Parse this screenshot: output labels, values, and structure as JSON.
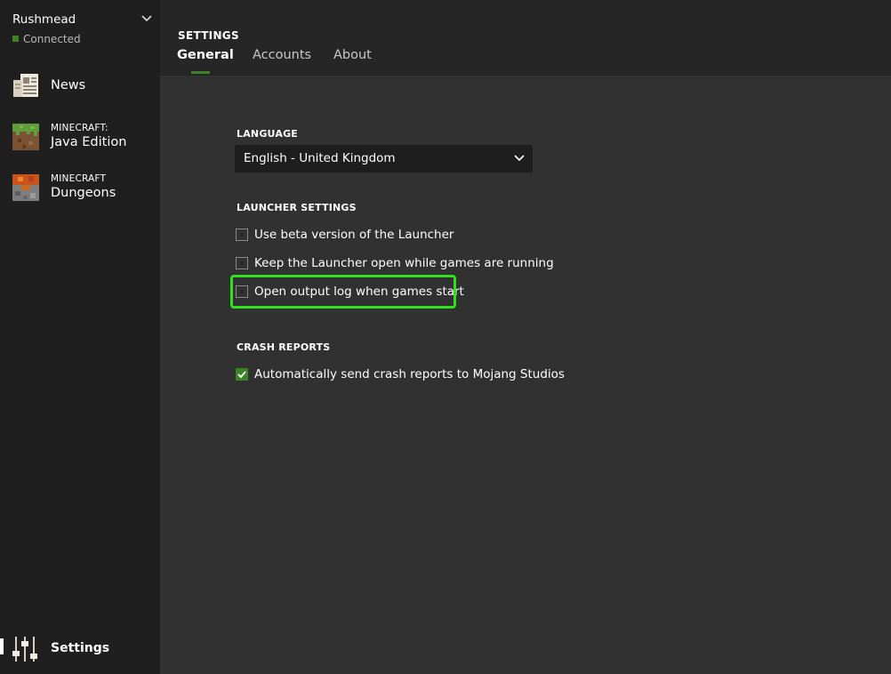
{
  "sidebar": {
    "account": {
      "name": "Rushmead",
      "status": "Connected"
    },
    "items": [
      {
        "label": "News",
        "icon": "newspaper-icon"
      },
      {
        "brand": "MINECRAFT:",
        "label": "Java Edition",
        "icon": "grass-block-icon"
      },
      {
        "brand": "MINECRAFT",
        "label": "Dungeons",
        "icon": "dungeons-block-icon"
      }
    ],
    "settings_label": "Settings"
  },
  "header": {
    "title": "SETTINGS",
    "tabs": [
      {
        "label": "General",
        "active": true
      },
      {
        "label": "Accounts",
        "active": false
      },
      {
        "label": "About",
        "active": false
      }
    ]
  },
  "general": {
    "language": {
      "heading": "LANGUAGE",
      "value": "English - United Kingdom"
    },
    "launcher": {
      "heading": "LAUNCHER SETTINGS",
      "options": [
        {
          "label": "Use beta version of the Launcher",
          "checked": false
        },
        {
          "label": "Keep the Launcher open while games are running",
          "checked": false
        },
        {
          "label": "Open output log when games start",
          "checked": false
        }
      ]
    },
    "crash": {
      "heading": "CRASH REPORTS",
      "options": [
        {
          "label": "Automatically send crash reports to Mojang Studios",
          "checked": true
        }
      ]
    }
  },
  "colors": {
    "accent_green": "#3c8527",
    "highlight_green": "#2ee11a",
    "sidebar_bg": "#1f1f1f",
    "content_bg": "#313131"
  }
}
